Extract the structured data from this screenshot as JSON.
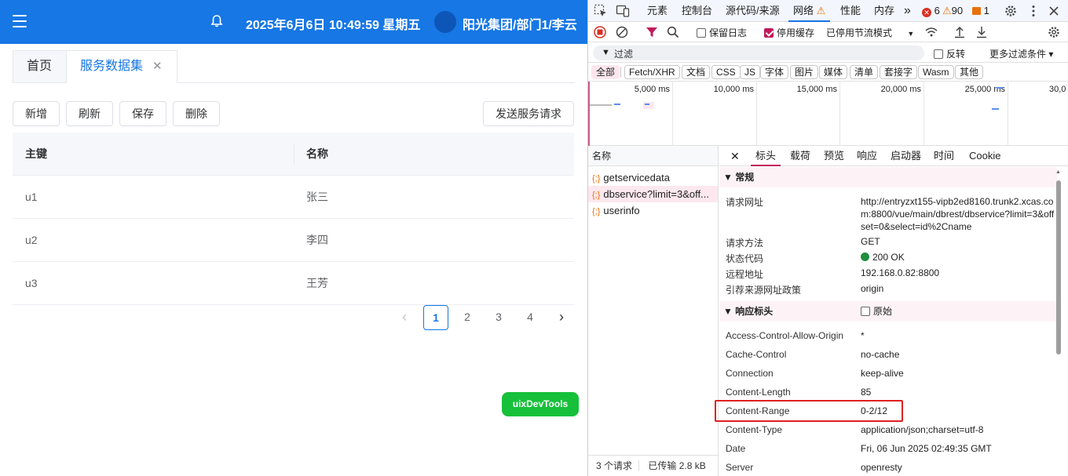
{
  "app": {
    "datetime": "2025年6月6日 10:49:59 星期五",
    "user": "阳光集团/部门1/李云",
    "tabs": [
      {
        "label": "首页"
      },
      {
        "label": "服务数据集",
        "close": "✕"
      }
    ],
    "toolbar": {
      "add": "新增",
      "refresh": "刷新",
      "save": "保存",
      "delete": "删除",
      "send": "发送服务请求"
    },
    "table": {
      "headers": [
        "主键",
        "名称"
      ],
      "rows": [
        [
          "u1",
          "张三"
        ],
        [
          "u2",
          "李四"
        ],
        [
          "u3",
          "王芳"
        ]
      ]
    },
    "pagination": {
      "prev": "‹",
      "pages": [
        "1",
        "2",
        "3",
        "4"
      ],
      "next": "›",
      "current": "1"
    },
    "devtools_button": "uixDevTools",
    "colors": {
      "primary": "#1677e5",
      "green": "#16c03a"
    }
  },
  "devtools": {
    "tabs": [
      "元素",
      "控制台",
      "源代码/来源",
      "网络",
      "性能",
      "内存",
      "»"
    ],
    "warning_icon": "⚠",
    "counts": {
      "errors": "6",
      "warnings": "90",
      "info": "1"
    },
    "toolbar": {
      "preserve_log": "保留日志",
      "disable_cache": "停用缓存",
      "throttle": "已停用节流模式"
    },
    "filter": {
      "placeholder": "过滤",
      "invert": "反转",
      "more": "更多过滤条件 ▾"
    },
    "types": [
      "全部",
      "Fetch/XHR",
      "文档",
      "CSS",
      "JS",
      "字体",
      "图片",
      "媒体",
      "清单",
      "套接字",
      "Wasm",
      "其他"
    ],
    "timeline_ticks": [
      "5,000 ms",
      "10,000 ms",
      "15,000 ms",
      "20,000 ms",
      "25,000 ms",
      "30,0"
    ],
    "list_header": "名称",
    "requests": [
      "getservicedata",
      "dbservice?limit=3&off...",
      "userinfo"
    ],
    "json_icon": "{;}",
    "footer": {
      "count": "3 个请求",
      "transferred": "已传输 2.8 kB"
    },
    "detail_tabs": [
      "✕",
      "标头",
      "载荷",
      "预览",
      "响应",
      "启动器",
      "时间",
      "Cookie"
    ],
    "general": {
      "title": "▼ 常规",
      "rows": [
        {
          "k": "请求网址",
          "v": "http://entryzxt155-vipb2ed8160.trunk2.xcas.com:8800/vue/main/dbrest/dbservice?limit=3&offset=0&select=id%2Cname"
        },
        {
          "k": "请求方法",
          "v": "GET"
        },
        {
          "k": "状态代码",
          "v": "200 OK"
        },
        {
          "k": "远程地址",
          "v": "192.168.0.82:8800"
        },
        {
          "k": "引荐来源网址政策",
          "v": "origin"
        }
      ]
    },
    "response_headers": {
      "title": "▼ 响应标头",
      "raw": "原始",
      "rows": [
        {
          "k": "Access-Control-Allow-Origin",
          "v": "*"
        },
        {
          "k": "Cache-Control",
          "v": "no-cache"
        },
        {
          "k": "Connection",
          "v": "keep-alive"
        },
        {
          "k": "Content-Length",
          "v": "85"
        },
        {
          "k": "Content-Range",
          "v": "0-2/12"
        },
        {
          "k": "Content-Type",
          "v": "application/json;charset=utf-8"
        },
        {
          "k": "Date",
          "v": "Fri, 06 Jun 2025 02:49:35 GMT"
        },
        {
          "k": "Server",
          "v": "openresty"
        }
      ]
    }
  }
}
